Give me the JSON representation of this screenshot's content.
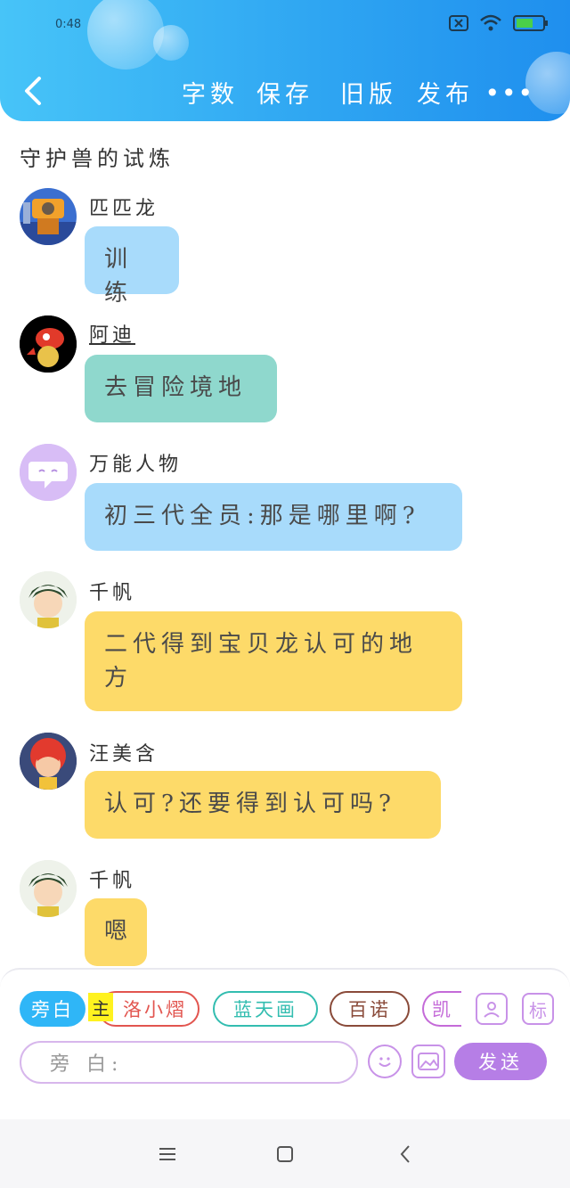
{
  "status": {
    "time": "0:48"
  },
  "header": {
    "buttons": [
      {
        "label": "字数"
      },
      {
        "label": "保存"
      },
      {
        "label": "旧版"
      },
      {
        "label": "发布"
      }
    ],
    "more": "•••"
  },
  "story_title": "守护兽的试炼",
  "messages": [
    {
      "name": "匹匹龙",
      "text": "训练",
      "color": "#a8dbfb"
    },
    {
      "name": "阿迪",
      "text": "去冒险境地",
      "color": "#8fd8cd"
    },
    {
      "name": "万能人物",
      "text": "初三代全员:那是哪里啊?",
      "color": "#a8dbfb"
    },
    {
      "name": "千帆",
      "text": "二代得到宝贝龙认可的地方",
      "color": "#fdda69"
    },
    {
      "name": "汪美含",
      "text": "认可?还要得到认可吗?",
      "color": "#fdda69"
    },
    {
      "name": "千帆",
      "text": "嗯",
      "color": "#fdda69"
    }
  ],
  "characters": {
    "active": "旁白",
    "main_tag": "主",
    "items": [
      {
        "label": "洛小熠",
        "color": "#e2554f"
      },
      {
        "label": "蓝天画",
        "color": "#33bdb0"
      },
      {
        "label": "百诺",
        "color": "#8a4b3a"
      },
      {
        "label": "凯",
        "color": "#c46ad8"
      }
    ],
    "tag_button": "标"
  },
  "input": {
    "placeholder": "旁 白:"
  },
  "send_label": "发送"
}
